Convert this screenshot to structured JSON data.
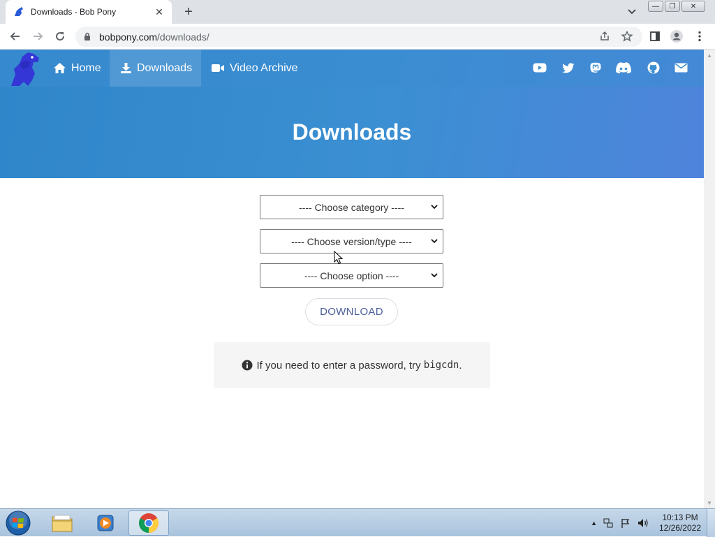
{
  "browser": {
    "tab_title": "Downloads - Bob Pony",
    "url_host": "bobpony.com",
    "url_path": "/downloads/"
  },
  "nav": {
    "home": "Home",
    "downloads": "Downloads",
    "video_archive": "Video Archive",
    "social_icons": [
      "youtube-icon",
      "twitter-icon",
      "mastodon-icon",
      "discord-icon",
      "github-icon",
      "email-icon"
    ]
  },
  "hero": {
    "title": "Downloads"
  },
  "form": {
    "category_placeholder": "---- Choose category ----",
    "version_placeholder": "---- Choose version/type ----",
    "option_placeholder": "---- Choose option ----",
    "download_label": "DOWNLOAD"
  },
  "note": {
    "text_before": "If you need to enter a password, try ",
    "password": "bigcdn",
    "text_after": "."
  },
  "taskbar": {
    "time": "10:13 PM",
    "date": "12/26/2022"
  },
  "colors": {
    "hero_blue": "#3b8fd2",
    "button_text": "#4a5f9a"
  }
}
